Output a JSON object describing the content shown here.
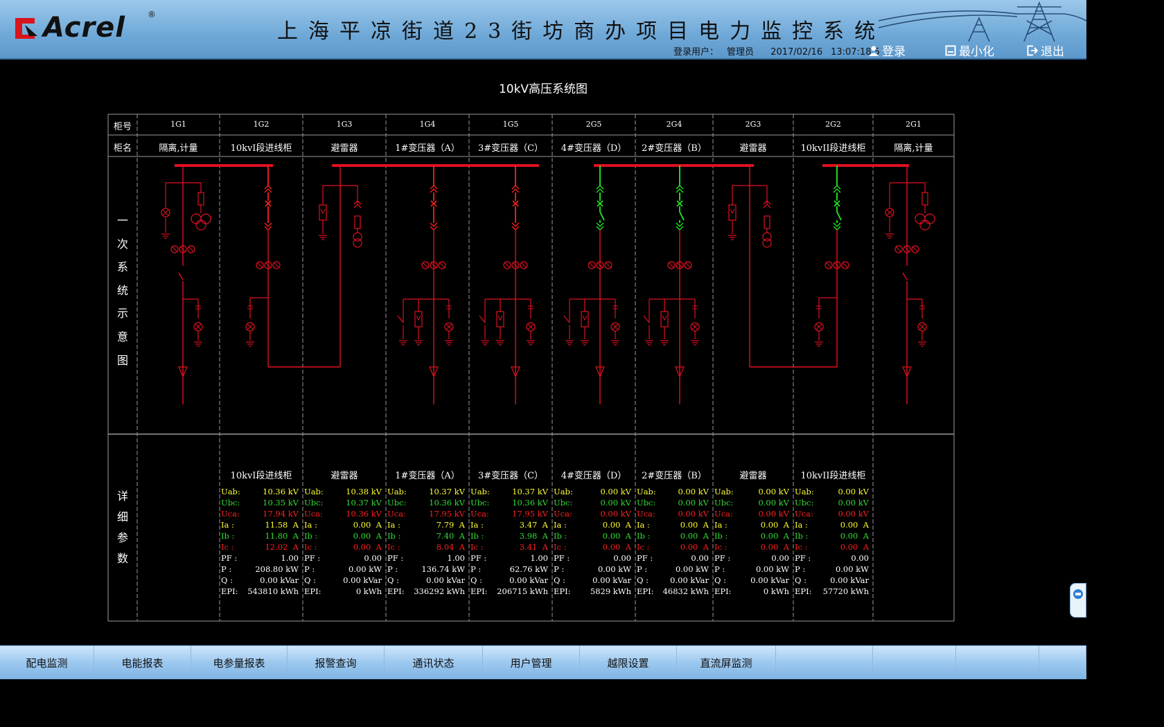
{
  "header": {
    "brand": "Acrel",
    "brand_reg": "®",
    "title": "上海平凉街道23街坊商办项目电力监控系统",
    "login_label": "登录用户：",
    "user": "管理员",
    "date": "2017/02/16",
    "time": "13:07:18.5",
    "login_btn": "登录",
    "minimize_btn": "最小化",
    "exit_btn": "退出"
  },
  "page_title": "10kV高压系统图",
  "table": {
    "row_label_id": "柜号",
    "row_label_name": "柜名",
    "section_one_line": [
      "一",
      "次",
      "系",
      "统",
      "示",
      "意",
      "图"
    ],
    "section_detail": [
      "详",
      "细",
      "参",
      "数"
    ],
    "cabinets": [
      {
        "id": "1G1",
        "name": "隔离,计量"
      },
      {
        "id": "1G2",
        "name": "10kvI段进线柜"
      },
      {
        "id": "1G3",
        "name": "避雷器"
      },
      {
        "id": "1G4",
        "name": "1#变压器（A）"
      },
      {
        "id": "1G5",
        "name": "3#变压器（C）"
      },
      {
        "id": "2G5",
        "name": "4#变压器（D）"
      },
      {
        "id": "2G4",
        "name": "2#变压器（B）"
      },
      {
        "id": "2G3",
        "name": "避雷器"
      },
      {
        "id": "2G2",
        "name": "10kvII段进线柜"
      },
      {
        "id": "2G1",
        "name": "隔离,计量"
      }
    ]
  },
  "params": [
    {
      "title": "10kvI段进线柜",
      "rows": [
        {
          "label": "Uab:",
          "value": "10.36 kV",
          "color": "#ffff33"
        },
        {
          "label": "Ubc:",
          "value": "10.35 kV",
          "color": "#33dd33"
        },
        {
          "label": "Uca:",
          "value": "17.94 kV",
          "color": "#ff2020"
        },
        {
          "label": "Ia :",
          "value": "11.58  A",
          "color": "#ffff33"
        },
        {
          "label": "Ib :",
          "value": "11.80  A",
          "color": "#33dd33"
        },
        {
          "label": "Ic :",
          "value": "12.02  A",
          "color": "#ff2020"
        },
        {
          "label": "PF :",
          "value": "1.00",
          "color": "#ffffff"
        },
        {
          "label": "P  :",
          "value": "208.80 kW",
          "color": "#ffffff"
        },
        {
          "label": "Q  :",
          "value": "0.00 kVar",
          "color": "#ffffff"
        },
        {
          "label": "EPI:",
          "value": "543810 kWh",
          "color": "#ffffff"
        }
      ]
    },
    {
      "title": "避雷器",
      "rows": [
        {
          "label": "Uab:",
          "value": "10.38 kV",
          "color": "#ffff33"
        },
        {
          "label": "Ubc:",
          "value": "10.37 kV",
          "color": "#33dd33"
        },
        {
          "label": "Uca:",
          "value": "10.36 kV",
          "color": "#ff2020"
        },
        {
          "label": "Ia :",
          "value": "0.00  A",
          "color": "#ffff33"
        },
        {
          "label": "Ib :",
          "value": "0.00  A",
          "color": "#33dd33"
        },
        {
          "label": "Ic :",
          "value": "0.00  A",
          "color": "#ff2020"
        },
        {
          "label": "PF :",
          "value": "0.00",
          "color": "#ffffff"
        },
        {
          "label": "P  :",
          "value": "0.00 kW",
          "color": "#ffffff"
        },
        {
          "label": "Q  :",
          "value": "0.00 kVar",
          "color": "#ffffff"
        },
        {
          "label": "EPI:",
          "value": "0 kWh",
          "color": "#ffffff"
        }
      ]
    },
    {
      "title": "1#变压器（A）",
      "rows": [
        {
          "label": "Uab:",
          "value": "10.37 kV",
          "color": "#ffff33"
        },
        {
          "label": "Ubc:",
          "value": "10.36 kV",
          "color": "#33dd33"
        },
        {
          "label": "Uca:",
          "value": "17.95 kV",
          "color": "#ff2020"
        },
        {
          "label": "Ia :",
          "value": "7.79  A",
          "color": "#ffff33"
        },
        {
          "label": "Ib :",
          "value": "7.40  A",
          "color": "#33dd33"
        },
        {
          "label": "Ic :",
          "value": "8.04  A",
          "color": "#ff2020"
        },
        {
          "label": "PF :",
          "value": "1.00",
          "color": "#ffffff"
        },
        {
          "label": "P  :",
          "value": "136.74 kW",
          "color": "#ffffff"
        },
        {
          "label": "Q  :",
          "value": "0.00 kVar",
          "color": "#ffffff"
        },
        {
          "label": "EPI:",
          "value": "336292 kWh",
          "color": "#ffffff"
        }
      ]
    },
    {
      "title": "3#变压器（C）",
      "rows": [
        {
          "label": "Uab:",
          "value": "10.37 kV",
          "color": "#ffff33"
        },
        {
          "label": "Ubc:",
          "value": "10.36 kV",
          "color": "#33dd33"
        },
        {
          "label": "Uca:",
          "value": "17.95 kV",
          "color": "#ff2020"
        },
        {
          "label": "Ia :",
          "value": "3.47  A",
          "color": "#ffff33"
        },
        {
          "label": "Ib :",
          "value": "3.98  A",
          "color": "#33dd33"
        },
        {
          "label": "Ic :",
          "value": "3.41  A",
          "color": "#ff2020"
        },
        {
          "label": "PF :",
          "value": "1.00",
          "color": "#ffffff"
        },
        {
          "label": "P  :",
          "value": "62.76 kW",
          "color": "#ffffff"
        },
        {
          "label": "Q  :",
          "value": "0.00 kVar",
          "color": "#ffffff"
        },
        {
          "label": "EPI:",
          "value": "206715 kWh",
          "color": "#ffffff"
        }
      ]
    },
    {
      "title": "4#变压器（D）",
      "rows": [
        {
          "label": "Uab:",
          "value": "0.00 kV",
          "color": "#ffff33"
        },
        {
          "label": "Ubc:",
          "value": "0.00 kV",
          "color": "#33dd33"
        },
        {
          "label": "Uca:",
          "value": "0.00 kV",
          "color": "#ff2020"
        },
        {
          "label": "Ia :",
          "value": "0.00  A",
          "color": "#ffff33"
        },
        {
          "label": "Ib :",
          "value": "0.00  A",
          "color": "#33dd33"
        },
        {
          "label": "Ic :",
          "value": "0.00  A",
          "color": "#ff2020"
        },
        {
          "label": "PF :",
          "value": "0.00",
          "color": "#ffffff"
        },
        {
          "label": "P  :",
          "value": "0.00 kW",
          "color": "#ffffff"
        },
        {
          "label": "Q  :",
          "value": "0.00 kVar",
          "color": "#ffffff"
        },
        {
          "label": "EPI:",
          "value": "5829 kWh",
          "color": "#ffffff"
        }
      ]
    },
    {
      "title": "2#变压器（B）",
      "rows": [
        {
          "label": "Uab:",
          "value": "0.00 kV",
          "color": "#ffff33"
        },
        {
          "label": "Ubc:",
          "value": "0.00 kV",
          "color": "#33dd33"
        },
        {
          "label": "Uca:",
          "value": "0.00 kV",
          "color": "#ff2020"
        },
        {
          "label": "Ia :",
          "value": "0.00  A",
          "color": "#ffff33"
        },
        {
          "label": "Ib :",
          "value": "0.00  A",
          "color": "#33dd33"
        },
        {
          "label": "Ic :",
          "value": "0.00  A",
          "color": "#ff2020"
        },
        {
          "label": "PF :",
          "value": "0.00",
          "color": "#ffffff"
        },
        {
          "label": "P  :",
          "value": "0.00 kW",
          "color": "#ffffff"
        },
        {
          "label": "Q  :",
          "value": "0.00 kVar",
          "color": "#ffffff"
        },
        {
          "label": "EPI:",
          "value": "46832 kWh",
          "color": "#ffffff"
        }
      ]
    },
    {
      "title": "避雷器",
      "rows": [
        {
          "label": "Uab:",
          "value": "0.00 kV",
          "color": "#ffff33"
        },
        {
          "label": "Ubc:",
          "value": "0.00 kV",
          "color": "#33dd33"
        },
        {
          "label": "Uca:",
          "value": "0.00 kV",
          "color": "#ff2020"
        },
        {
          "label": "Ia :",
          "value": "0.00  A",
          "color": "#ffff33"
        },
        {
          "label": "Ib :",
          "value": "0.00  A",
          "color": "#33dd33"
        },
        {
          "label": "Ic :",
          "value": "0.00  A",
          "color": "#ff2020"
        },
        {
          "label": "PF :",
          "value": "0.00",
          "color": "#ffffff"
        },
        {
          "label": "P  :",
          "value": "0.00 kW",
          "color": "#ffffff"
        },
        {
          "label": "Q  :",
          "value": "0.00 kVar",
          "color": "#ffffff"
        },
        {
          "label": "EPI:",
          "value": "0 kWh",
          "color": "#ffffff"
        }
      ]
    },
    {
      "title": "10kvII段进线柜",
      "rows": [
        {
          "label": "Uab:",
          "value": "0.00 kV",
          "color": "#ffff33"
        },
        {
          "label": "Ubc:",
          "value": "0.00 kV",
          "color": "#33dd33"
        },
        {
          "label": "Uca:",
          "value": "0.00 kV",
          "color": "#ff2020"
        },
        {
          "label": "Ia :",
          "value": "0.00  A",
          "color": "#ffff33"
        },
        {
          "label": "Ib :",
          "value": "0.00  A",
          "color": "#33dd33"
        },
        {
          "label": "Ic :",
          "value": "0.00  A",
          "color": "#ff2020"
        },
        {
          "label": "PF :",
          "value": "0.00",
          "color": "#ffffff"
        },
        {
          "label": "P  :",
          "value": "0.00 kW",
          "color": "#ffffff"
        },
        {
          "label": "Q  :",
          "value": "0.00 kVar",
          "color": "#ffffff"
        },
        {
          "label": "EPI:",
          "value": "57720 kWh",
          "color": "#ffffff"
        }
      ]
    }
  ],
  "nav": [
    "配电监测",
    "电能报表",
    "电参量报表",
    "报警查询",
    "通讯状态",
    "用户管理",
    "越限设置",
    "直流屏监测"
  ],
  "colors": {
    "energized": "#e01020",
    "closed_switch": "#ff2020",
    "open_switch": "#22ee22",
    "grid": "#9a9a9a",
    "header_bg": "#7fb4e4"
  }
}
